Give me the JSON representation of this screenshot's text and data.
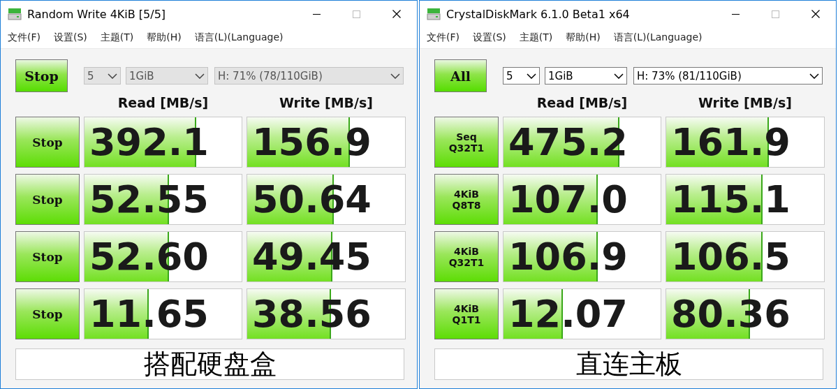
{
  "windows": [
    {
      "title": "Random Write 4KiB [5/5]",
      "menu": [
        "文件(F)",
        "设置(S)",
        "主题(T)",
        "帮助(H)",
        "语言(L)(Language)"
      ],
      "main_button": "Stop",
      "selects": [
        {
          "kind": "count",
          "value": "5",
          "disabled": true
        },
        {
          "kind": "size",
          "value": "1GiB",
          "disabled": true
        },
        {
          "kind": "drive",
          "value": "H: 71% (78/110GiB)",
          "disabled": true
        }
      ],
      "headers": [
        "Read [MB/s]",
        "Write [MB/s]"
      ],
      "rows": [
        {
          "label": "Stop",
          "read": {
            "value": "392.1",
            "level": 0.7
          },
          "write": {
            "value": "156.9",
            "level": 0.64
          }
        },
        {
          "label": "Stop",
          "read": {
            "value": "52.55",
            "level": 0.53
          },
          "write": {
            "value": "50.64",
            "level": 0.54
          }
        },
        {
          "label": "Stop",
          "read": {
            "value": "52.60",
            "level": 0.53
          },
          "write": {
            "value": "49.45",
            "level": 0.53
          }
        },
        {
          "label": "Stop",
          "read": {
            "value": "11.65",
            "level": 0.4
          },
          "write": {
            "value": "38.56",
            "level": 0.52
          }
        }
      ],
      "comment": "搭配硬盘盒"
    },
    {
      "title": "CrystalDiskMark 6.1.0 Beta1 x64",
      "menu": [
        "文件(F)",
        "设置(S)",
        "主题(T)",
        "帮助(H)",
        "语言(L)(Language)"
      ],
      "main_button": "All",
      "selects": [
        {
          "kind": "count",
          "value": "5",
          "disabled": false
        },
        {
          "kind": "size",
          "value": "1GiB",
          "disabled": false
        },
        {
          "kind": "drive",
          "value": "H: 73% (81/110GiB)",
          "disabled": false
        }
      ],
      "headers": [
        "Read [MB/s]",
        "Write [MB/s]"
      ],
      "rows": [
        {
          "label": "Seq\nQ32T1",
          "read": {
            "value": "475.2",
            "level": 0.73
          },
          "write": {
            "value": "161.9",
            "level": 0.64
          }
        },
        {
          "label": "4KiB\nQ8T8",
          "read": {
            "value": "107.0",
            "level": 0.59
          },
          "write": {
            "value": "115.1",
            "level": 0.6
          }
        },
        {
          "label": "4KiB\nQ32T1",
          "read": {
            "value": "106.9",
            "level": 0.59
          },
          "write": {
            "value": "106.5",
            "level": 0.6
          }
        },
        {
          "label": "4KiB\nQ1T1",
          "read": {
            "value": "12.07",
            "level": 0.37
          },
          "write": {
            "value": "80.36",
            "level": 0.52
          }
        }
      ],
      "comment": "直连主板"
    }
  ]
}
